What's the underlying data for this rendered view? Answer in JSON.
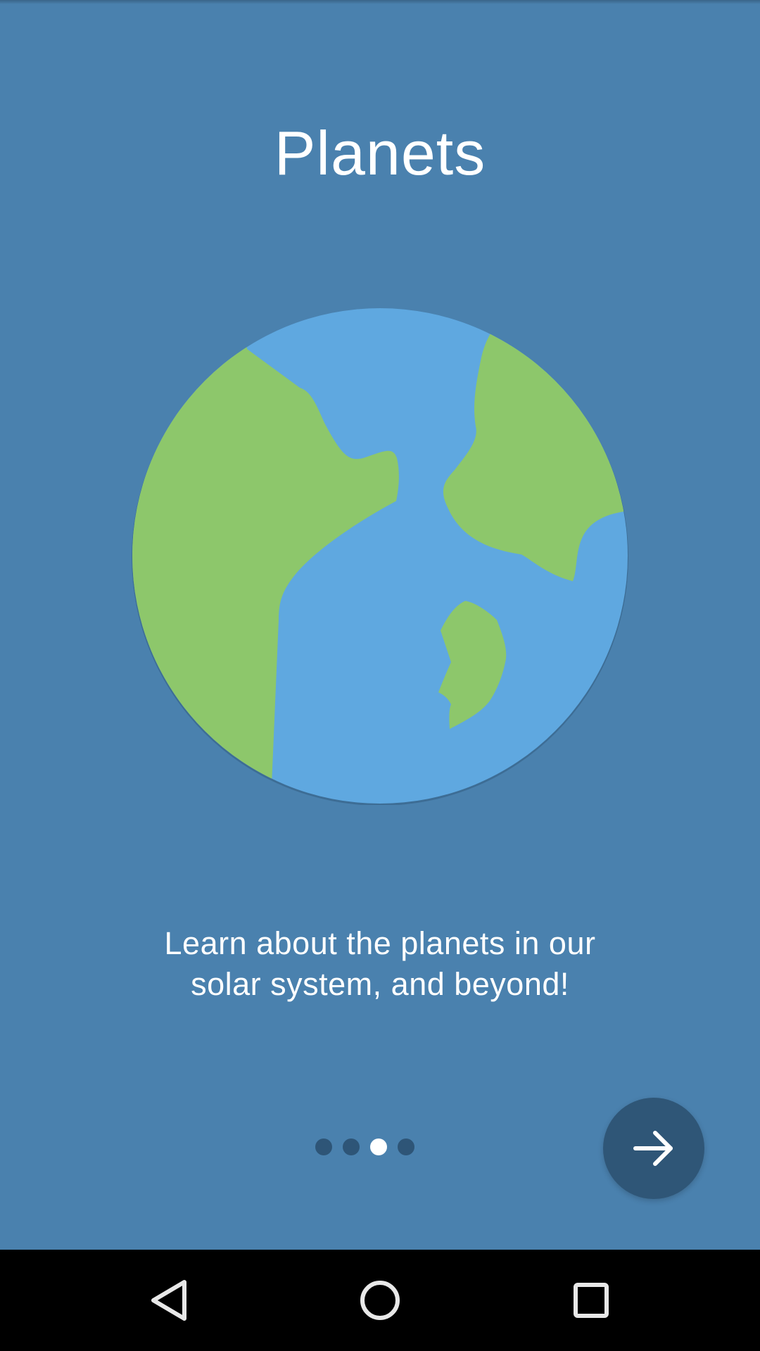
{
  "onboarding": {
    "title": "Planets",
    "description_lines": [
      "Learn about the planets in our",
      "solar system, and beyond!"
    ],
    "illustration": "globe-illustration",
    "page_indicator": {
      "total": 4,
      "active_index": 2
    },
    "next_button_icon": "arrow-right-icon"
  },
  "navigation_bar": {
    "back_icon": "back-triangle-icon",
    "home_icon": "home-circle-icon",
    "recents_icon": "recents-square-icon"
  },
  "colors": {
    "background": "#4a81ae",
    "ocean": "#5fa8e0",
    "land": "#8dc76b",
    "dot_inactive": "#2e5577",
    "dot_active": "#ffffff",
    "fab": "#2f5677",
    "navbar": "#000000"
  }
}
